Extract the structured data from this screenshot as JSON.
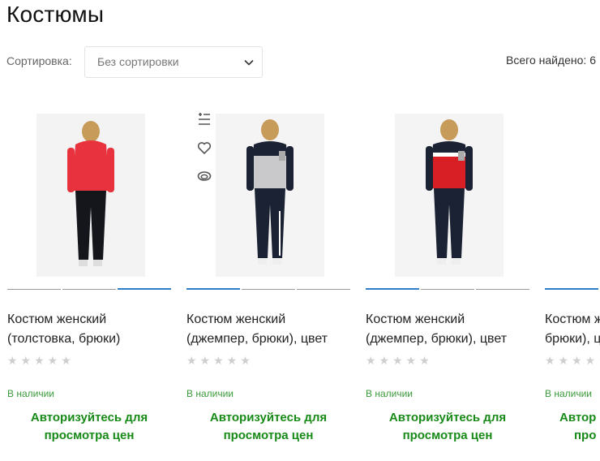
{
  "page_title": "Костюмы",
  "sort": {
    "label": "Сортировка:",
    "value": "Без сортировки"
  },
  "total": "Всего найдено: 6",
  "products": [
    {
      "name_line1": "Костюм женский",
      "name_line2": "(толстовка, брюки)",
      "stars": "★★★★★",
      "stock": "В наличии",
      "price_line1": "Авторизуйтесь для",
      "price_line2": "просмотра цен",
      "top_color": "#e8323e",
      "top_image_active_index": 2
    },
    {
      "name_line1": "Костюм женский",
      "name_line2": "(джемпер, брюки), цвет",
      "stars": "★★★★★",
      "stock": "В наличии",
      "price_line1": "Авторизуйтесь для",
      "price_line2": "просмотра цен",
      "top_color": "#c9c9cc",
      "top_image_active_index": 0
    },
    {
      "name_line1": "Костюм женский",
      "name_line2": "(джемпер, брюки), цвет",
      "stars": "★★★★★",
      "stock": "В наличии",
      "price_line1": "Авторизуйтесь для",
      "price_line2": "просмотра цен",
      "top_color": "#d81f26",
      "top_image_active_index": 0
    },
    {
      "name_line1": "Костюм ж",
      "name_line2": "брюки), ц",
      "stars": "★★★★★",
      "stock": "В наличии",
      "price_line1": "Автор",
      "price_line2": "про",
      "top_color": "#1b2233",
      "top_image_active_index": 0
    }
  ],
  "colors": {
    "accent": "#2f7ec8",
    "price": "#188a18",
    "stock": "#3b9a3b"
  },
  "icons": [
    "add-to-compare-icon",
    "heart-icon",
    "eye-icon",
    "chevron-down-icon"
  ]
}
